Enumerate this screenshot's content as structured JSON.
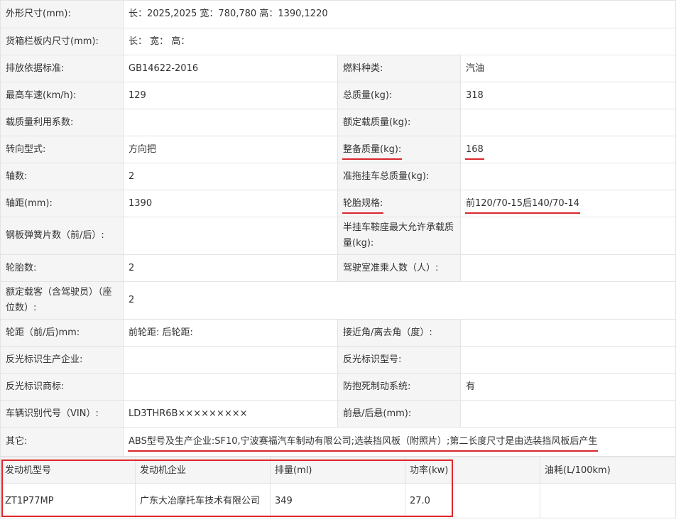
{
  "rows": [
    {
      "k1": "外形尺寸(mm):",
      "v1": "长：2025,2025 宽：780,780 高：1390,1220"
    },
    {
      "k1": "货箱栏板内尺寸(mm):",
      "v1": "长：  宽：  高："
    },
    {
      "k1": "排放依据标准:",
      "v1": "GB14622-2016",
      "k2": "燃料种类:",
      "v2": "汽油"
    },
    {
      "k1": "最高车速(km/h):",
      "v1": "129",
      "k2": "总质量(kg):",
      "v2": "318"
    },
    {
      "k1": "载质量利用系数:",
      "v1": "",
      "k2": "额定载质量(kg):",
      "v2": ""
    },
    {
      "k1": "转向型式:",
      "v1": "方向把",
      "k2": "整备质量(kg):",
      "v2": "168"
    },
    {
      "k1": "轴数:",
      "v1": "2",
      "k2": "准拖挂车总质量(kg):",
      "v2": ""
    },
    {
      "k1": "轴距(mm):",
      "v1": "1390",
      "k2": "轮胎规格:",
      "v2": "前120/70-15后140/70-14"
    },
    {
      "k1": "钢板弹簧片数（前/后）:",
      "v1": "",
      "k2": "半挂车鞍座最大允许承载质量(kg):",
      "v2": ""
    },
    {
      "k1": "轮胎数:",
      "v1": "2",
      "k2": "驾驶室准乘人数（人）:",
      "v2": ""
    },
    {
      "k1": "额定载客（含驾驶员）（座位数）:",
      "v1": "2"
    },
    {
      "k1": "轮距（前/后)mm:",
      "v1": "前轮距: 后轮距:",
      "k2": "接近角/离去角（度）:",
      "v2": ""
    },
    {
      "k1": "反光标识生产企业:",
      "v1": "",
      "k2": "反光标识型号:",
      "v2": ""
    },
    {
      "k1": "反光标识商标:",
      "v1": "",
      "k2": "防抱死制动系统:",
      "v2": "有"
    },
    {
      "k1": "车辆识别代号（VIN）:",
      "v1": "LD3THR6B×××××××××",
      "k2": "前悬/后悬(mm):",
      "v2": ""
    },
    {
      "k1": "其它:",
      "v1": "ABS型号及生产企业:SF10,宁波赛福汽车制动有限公司;选装挡风板（附照片）;第二长度尺寸是由选装挡风板后产生"
    }
  ],
  "engine": {
    "headers": [
      "发动机型号",
      "发动机企业",
      "排量(ml)",
      "功率(kw)",
      "油耗(L/100km)"
    ],
    "row": [
      "ZT1P77MP",
      "广东大冶摩托车技术有限公司",
      "349",
      "27.0",
      ""
    ]
  }
}
